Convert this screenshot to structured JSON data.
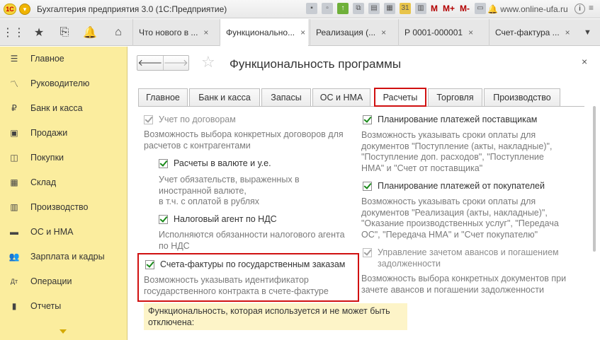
{
  "titlebar": {
    "logo": "1С",
    "title": "Бухгалтерия предприятия 3.0  (1С:Предприятие)",
    "m_labels": [
      "M",
      "M+",
      "M-"
    ],
    "site": "www.online-ufa.ru",
    "calendar_day": "31"
  },
  "tabs": [
    {
      "label": "Что нового в ...",
      "close": "×"
    },
    {
      "label": "Функционально...",
      "close": "×"
    },
    {
      "label": "Реализация (...",
      "close": "×"
    },
    {
      "label": "Р    0001-000001",
      "close": "×"
    },
    {
      "label": "Счет-фактура ...",
      "close": "×"
    }
  ],
  "sidebar": {
    "items": [
      {
        "label": "Главное",
        "icon": "menu-icon"
      },
      {
        "label": "Руководителю",
        "icon": "trend-icon"
      },
      {
        "label": "Банк и касса",
        "icon": "ruble-icon"
      },
      {
        "label": "Продажи",
        "icon": "cart-icon"
      },
      {
        "label": "Покупки",
        "icon": "basket-icon"
      },
      {
        "label": "Склад",
        "icon": "warehouse-icon"
      },
      {
        "label": "Производство",
        "icon": "factory-icon"
      },
      {
        "label": "ОС и НМА",
        "icon": "truck-icon"
      },
      {
        "label": "Зарплата и кадры",
        "icon": "people-icon"
      },
      {
        "label": "Операции",
        "icon": "dt-kt-icon"
      },
      {
        "label": "Отчеты",
        "icon": "bar-chart-icon"
      }
    ]
  },
  "page": {
    "title": "Функциональность программы",
    "close": "×",
    "func_tabs": [
      "Главное",
      "Банк и касса",
      "Запасы",
      "ОС и НМА",
      "Расчеты",
      "Торговля",
      "Производство"
    ],
    "active_tab": "Расчеты",
    "left": {
      "opt1": {
        "label": "Учет по договорам",
        "desc": [
          "Возможность выбора конкретных договоров для",
          "расчетов с контрагентами"
        ]
      },
      "opt2": {
        "label": "Расчеты в валюте и у.е.",
        "desc": [
          "Учет обязательств, выраженных в",
          "иностранной валюте,",
          "в т.ч. с оплатой в рублях"
        ]
      },
      "opt3": {
        "label": "Налоговый агент по НДС",
        "desc": [
          "Исполняются обязанности налогового агента",
          "по НДС"
        ]
      },
      "opt4": {
        "label": "Счета-фактуры по государственным заказам",
        "desc": [
          "Возможность указывать идентификатор",
          "государственного контракта в счете-фактуре"
        ]
      }
    },
    "right": {
      "opt1": {
        "label": "Планирование платежей поставщикам",
        "desc": [
          "Возможность указывать сроки оплаты для",
          "документов \"Поступление (акты, накладные)\",",
          "\"Поступление доп. расходов\", \"Поступление",
          "НМА\" и \"Счет от поставщика\""
        ]
      },
      "opt2": {
        "label": "Планирование платежей от покупателей",
        "desc": [
          "Возможность указывать сроки оплаты для",
          "документов \"Реализация (акты, накладные)\",",
          "\"Оказание производственных услуг\", \"Передача",
          "ОС\", \"Передача НМА\" и \"Счет покупателю\""
        ]
      },
      "opt3": {
        "label": "Управление зачетом авансов и погашением",
        "label2": "задолженности",
        "desc": [
          "Возможность выбора конкретных документов при",
          "зачете авансов и погашении задолженности"
        ]
      }
    },
    "note": [
      "Функциональность, которая используется и не может быть",
      "отключена:"
    ]
  }
}
